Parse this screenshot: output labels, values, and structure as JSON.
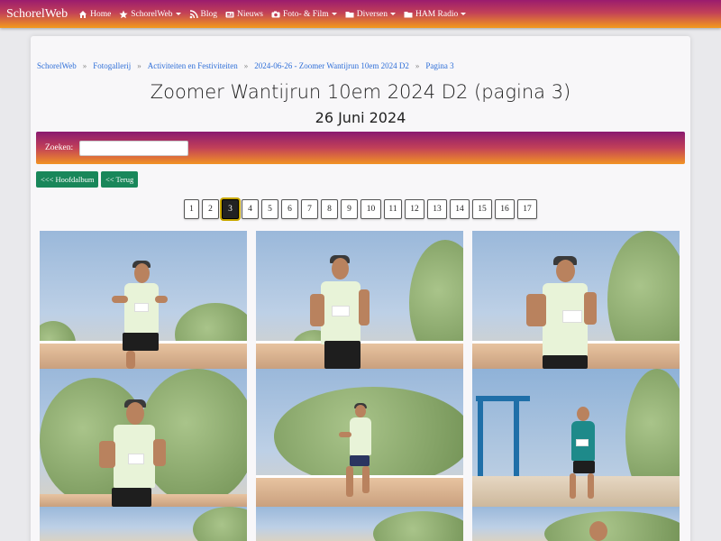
{
  "navbar": {
    "brand": "SchorelWeb",
    "items": [
      {
        "label": "Home",
        "icon": "home-icon",
        "dropdown": false
      },
      {
        "label": "SchorelWeb",
        "icon": "star-icon",
        "dropdown": true
      },
      {
        "label": "Blog",
        "icon": "rss-icon",
        "dropdown": false
      },
      {
        "label": "Nieuws",
        "icon": "newspaper-icon",
        "dropdown": false
      },
      {
        "label": "Foto- & Film",
        "icon": "camera-icon",
        "dropdown": true
      },
      {
        "label": "Diversen",
        "icon": "folder-icon",
        "dropdown": true
      },
      {
        "label": "HAM Radio",
        "icon": "folder-icon",
        "dropdown": true
      }
    ]
  },
  "breadcrumb": [
    "SchorelWeb",
    "Fotogallerij",
    "Activiteiten en Festiviteiten",
    "2024-06-26 - Zoomer Wantijrun 10em 2024 D2",
    "Pagina 3"
  ],
  "page": {
    "title": "Zoomer Wantijrun 10em 2024 D2 (pagina 3)",
    "subtitle": "26 Juni 2024"
  },
  "search": {
    "label": "Zoeken:",
    "value": "",
    "placeholder": ""
  },
  "buttons": {
    "main_album": "<<< Hoofdalbum",
    "back": "<< Terug"
  },
  "pagination": {
    "pages": [
      "1",
      "2",
      "3",
      "4",
      "5",
      "6",
      "7",
      "8",
      "9",
      "10",
      "11",
      "12",
      "13",
      "14",
      "15",
      "16",
      "17"
    ],
    "active": "3"
  },
  "colors": {
    "nav_gradient_top": "#9b1c6e",
    "nav_gradient_bottom": "#f39a1d",
    "link": "#2f6fd8",
    "button_green": "#19875a"
  }
}
